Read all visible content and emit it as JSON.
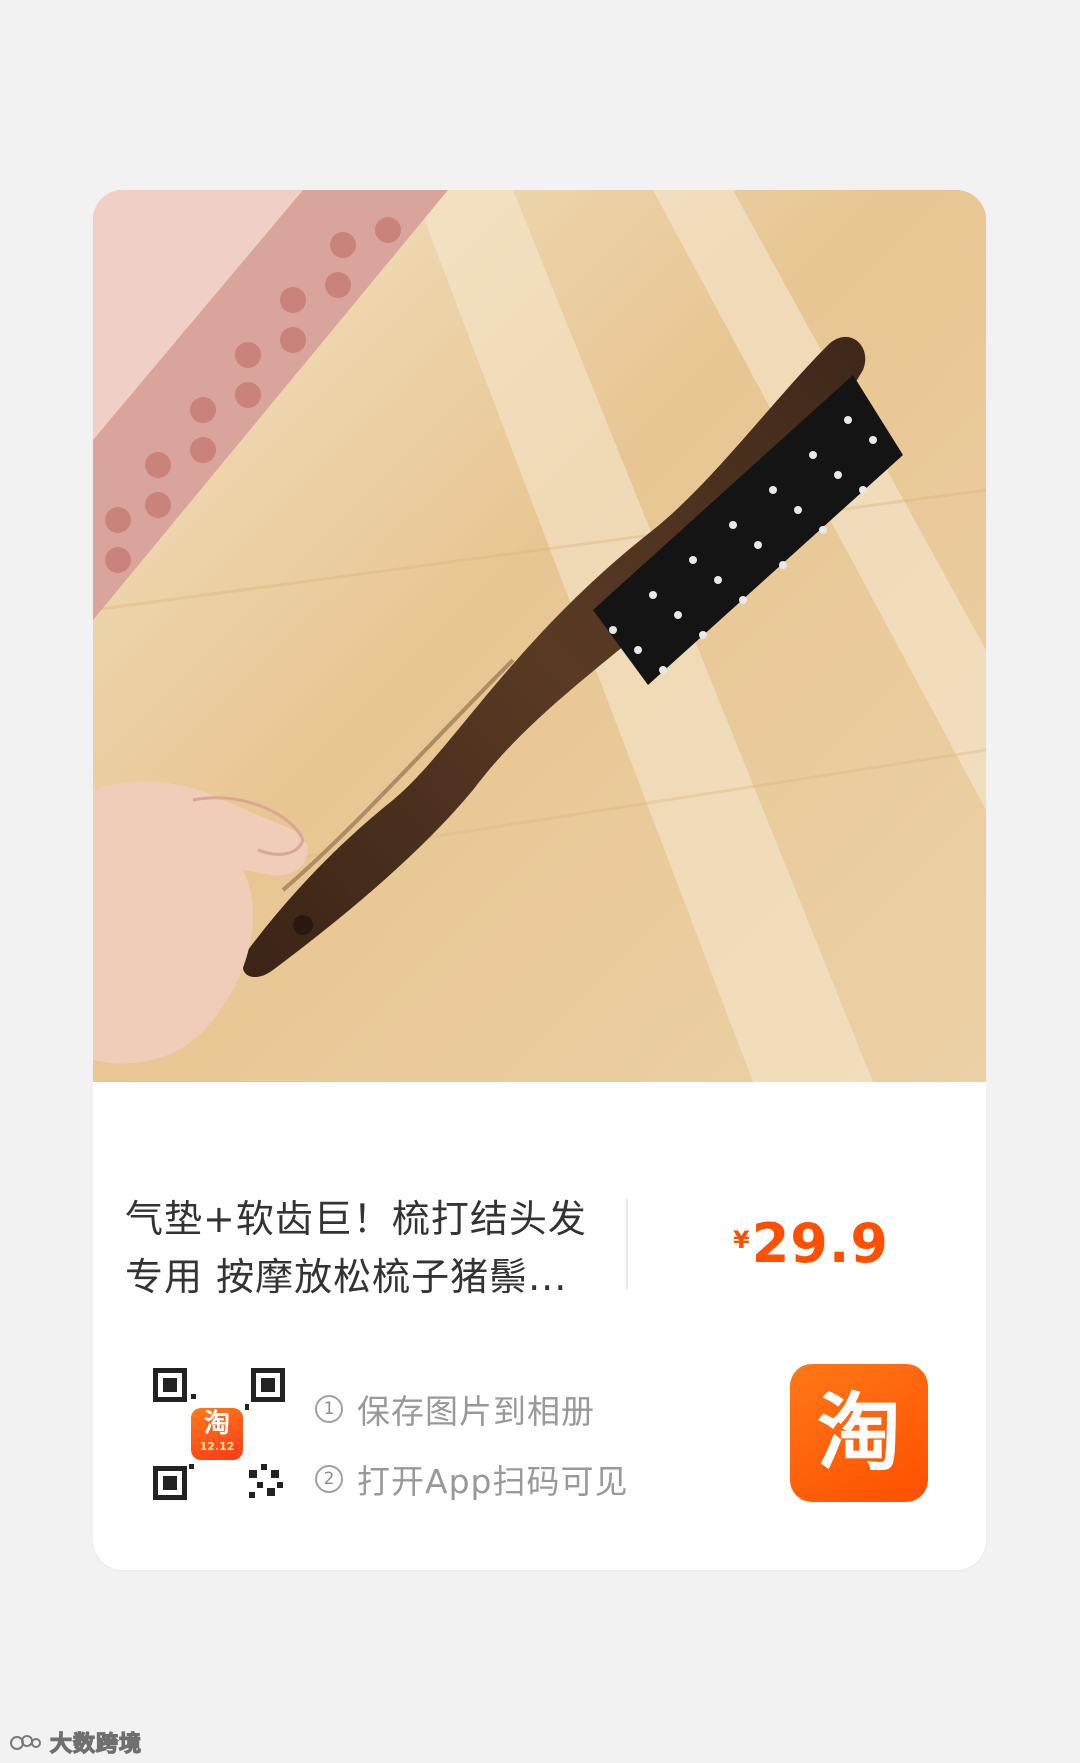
{
  "product": {
    "title": "气垫+软齿巨！梳打结头发专用 按摩放松梳子猪鬃...",
    "price_currency": "¥",
    "price_amount": "29.9",
    "image_description": "wooden-handle-boar-bristle-hairbrush-held-over-wood-table-with-pink-dotted-box"
  },
  "qr": {
    "badge_glyph": "淘",
    "badge_sub": "12.12"
  },
  "instructions": {
    "step1_num": "1",
    "step1_text": "保存图片到相册",
    "step2_num": "2",
    "step2_text": "打开App扫码可见"
  },
  "app_logo": {
    "glyph": "淘"
  },
  "watermark": {
    "text": "大数跨境"
  },
  "colors": {
    "accent": "#ff5000",
    "page_background": "#f2f2f2",
    "card_background": "#ffffff"
  }
}
